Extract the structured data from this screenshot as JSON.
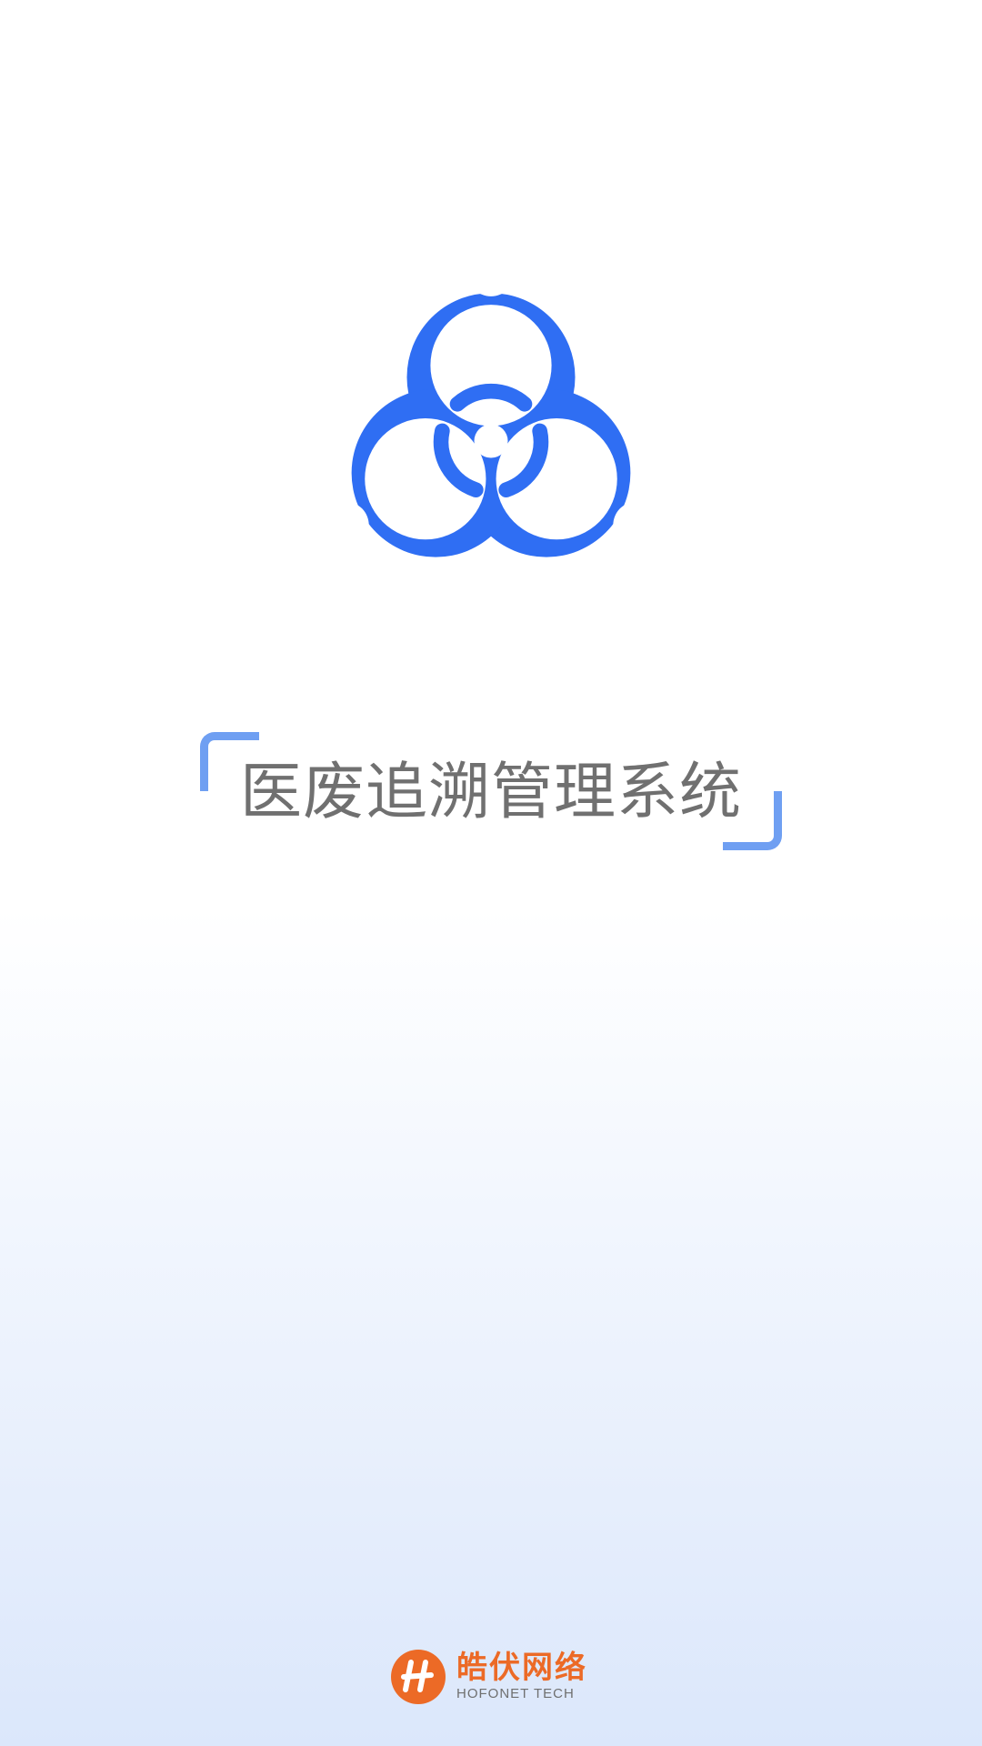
{
  "app": {
    "title": "医废追溯管理系统"
  },
  "logo": {
    "icon": "biohazard-icon",
    "color": "#2f6ef3"
  },
  "brand": {
    "name": "皓伏网络",
    "subtitle": "HOFONET TECH",
    "icon": "hofonet-logo-icon",
    "color": "#ec6a26"
  },
  "theme": {
    "title_color": "#707070",
    "bracket_color": "#6f9ff2",
    "background_bottom": "#dbe7fb"
  }
}
